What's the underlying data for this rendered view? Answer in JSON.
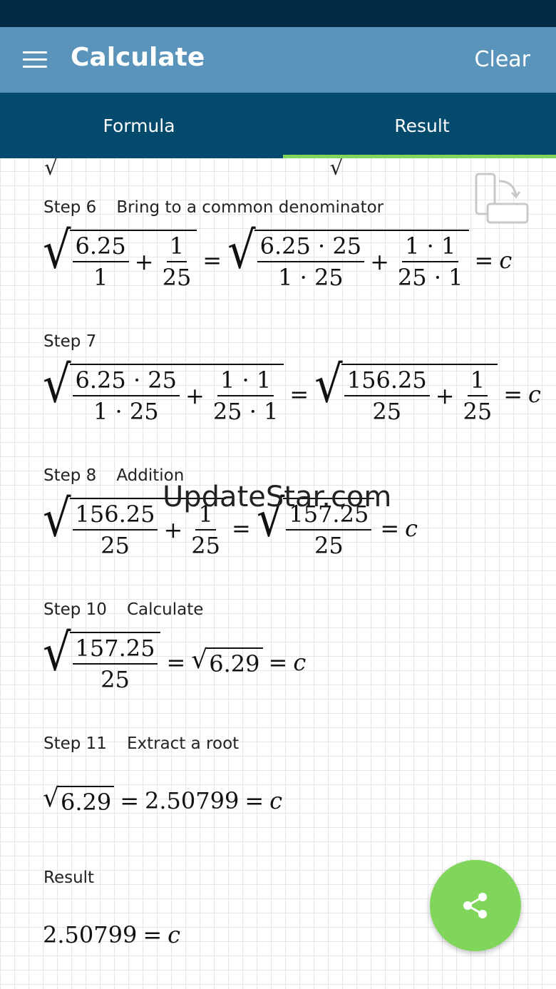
{
  "appbar": {
    "title": "Calculate",
    "clear_label": "Clear",
    "menu_icon": "menu-icon"
  },
  "tabs": [
    {
      "label": "Formula"
    },
    {
      "label": "Result",
      "active": true
    }
  ],
  "colors": {
    "statusbar": "#032a47",
    "appbar": "#5a94bb",
    "tabbar": "#034a6d",
    "accent": "#7fd65a"
  },
  "steps": [
    {
      "label": "Step 6",
      "desc": "Bring to a common denominator",
      "t": {
        "a_num": "6.25",
        "a_den": "1",
        "b_num": "1",
        "b_den": "25",
        "c_num": "6.25 · 25",
        "c_den": "1 · 25",
        "d_num": "1 · 1",
        "d_den": "25 · 1"
      }
    },
    {
      "label": "Step 7",
      "desc": "",
      "t": {
        "a_num": "6.25 · 25",
        "a_den": "1 · 25",
        "b_num": "1 · 1",
        "b_den": "25 · 1",
        "c_num": "156.25",
        "c_den": "25",
        "d_num": "1",
        "d_den": "25"
      }
    },
    {
      "label": "Step 8",
      "desc": "Addition",
      "t": {
        "a_num": "156.25",
        "a_den": "25",
        "b_num": "1",
        "b_den": "25",
        "c_num": "157.25",
        "c_den": "25"
      }
    },
    {
      "label": "Step 10",
      "desc": "Calculate",
      "t": {
        "a_num": "157.25",
        "a_den": "25",
        "root": "6.29"
      }
    },
    {
      "label": "Step 11",
      "desc": "Extract a root",
      "t": {
        "root": "6.29",
        "value": "2.50799"
      }
    }
  ],
  "result": {
    "label": "Result",
    "value": "2.50799"
  },
  "math": {
    "variable": "c",
    "plus": "+",
    "equals": "="
  },
  "watermark": "UpdateStar.com",
  "icons": {
    "rotate": "rotate-device-icon",
    "share": "share-icon"
  }
}
